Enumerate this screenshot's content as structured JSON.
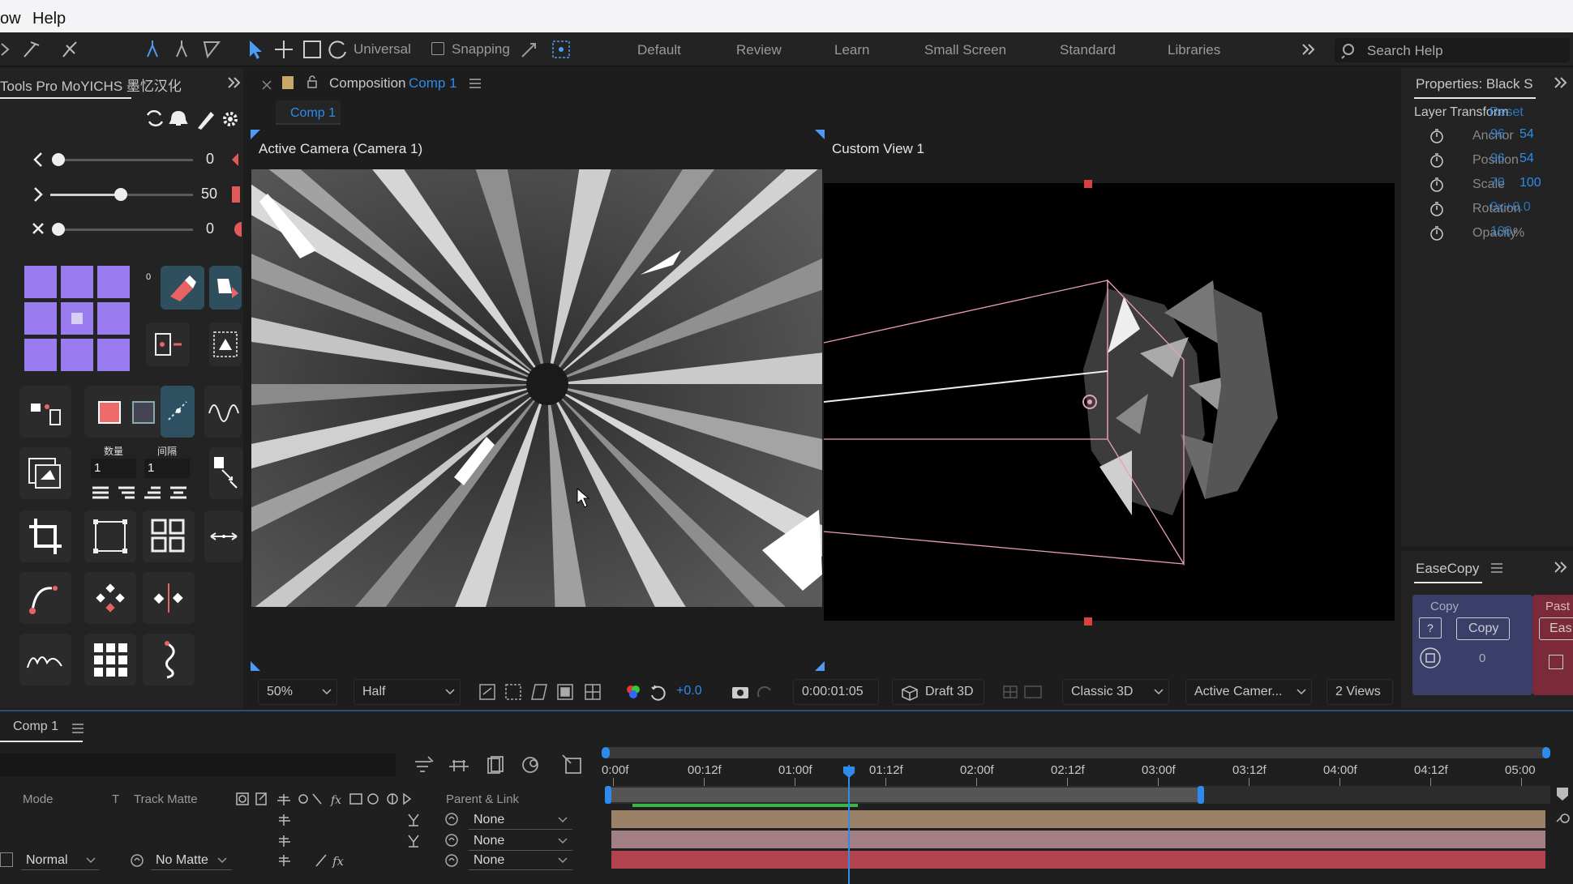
{
  "menu": {
    "items": [
      "ow",
      "Help"
    ]
  },
  "toolbar": {
    "universal_label": "Universal",
    "snapping_label": "Snapping",
    "workspaces": [
      "Default",
      "Review",
      "Learn",
      "Small Screen",
      "Standard",
      "Libraries"
    ],
    "search_placeholder": "Search Help"
  },
  "tools_panel": {
    "title": "Tools Pro MoYICHS 墨忆汉化",
    "sliders": [
      {
        "icon": "chevron-left-icon",
        "value": "0",
        "fraction": 0.0
      },
      {
        "icon": "chevron-right-icon",
        "value": "50",
        "fraction": 0.5
      },
      {
        "icon": "close-icon",
        "value": "0",
        "fraction": 0.0
      }
    ],
    "count_label_1": "数量",
    "count_label_2": "间隔",
    "count_value_1": "1",
    "count_value_2": "1",
    "tile_zero_label": "0"
  },
  "composition": {
    "panel_label": "Composition",
    "comp_name": "Comp 1",
    "tab_label": "Comp 1",
    "left_view_label": "Active Camera (Camera 1)",
    "right_view_label": "Custom View 1"
  },
  "viewer_bar": {
    "zoom": "50%",
    "resolution": "Half",
    "exposure": "+0.0",
    "timecode": "0:00:01:05",
    "draft": "Draft 3D",
    "renderer": "Classic 3D",
    "camera": "Active Camer...",
    "views": "2 Views"
  },
  "properties": {
    "title": "Properties: Black S",
    "section": "Layer Transform",
    "section_overlay": "Reset",
    "rows": [
      {
        "name": "Anchor",
        "v1": "96",
        "v2": "54"
      },
      {
        "name": "Position",
        "v1": "96",
        "v2": "54"
      },
      {
        "name": "Scale",
        "v1": "70",
        "v2": "100"
      },
      {
        "name": "Rotation",
        "v1": "0x",
        "v2": "+0.0"
      },
      {
        "name": "Opacity",
        "v1": "100",
        "v2": "%"
      }
    ]
  },
  "easecopy": {
    "title": "EaseCopy",
    "copy_group": "Copy",
    "copy_button": "Copy",
    "question": "?",
    "count": "0",
    "paste_group": "Past",
    "paste_button": "Eas"
  },
  "timeline": {
    "tab": "Comp 1",
    "columns": {
      "mode": "Mode",
      "t": "T",
      "track_matte": "Track Matte",
      "parent": "Parent & Link"
    },
    "ruler": [
      "0:00f",
      "00:12f",
      "01:00f",
      "01:12f",
      "02:00f",
      "02:12f",
      "03:00f",
      "03:12f",
      "04:00f",
      "04:12f",
      "05:00"
    ],
    "layers": [
      {
        "mode": "",
        "matte": "",
        "parent": "None",
        "color": "#9a8168"
      },
      {
        "mode": "",
        "matte": "",
        "parent": "None",
        "color": "#a17f85"
      },
      {
        "mode": "Normal",
        "matte": "No Matte",
        "parent": "None",
        "color": "#b2434e"
      }
    ],
    "playhead_fraction": 0.252,
    "work_area_end_fraction": 0.63
  },
  "colors": {
    "accent_blue": "#2d8ceb",
    "tile_purple": "#9a7cf0",
    "red": "#e05a5a"
  }
}
